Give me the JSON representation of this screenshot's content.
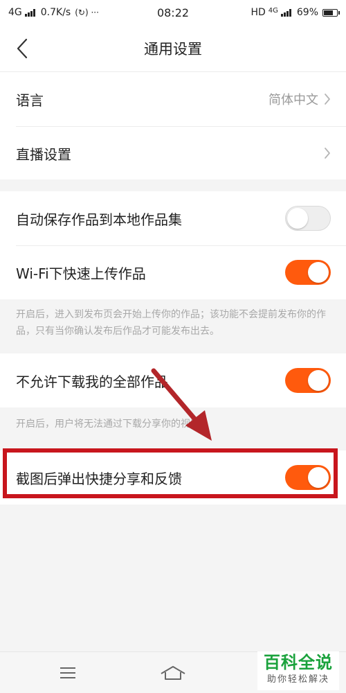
{
  "status_bar": {
    "network": "4G",
    "speed": "0.7K/s",
    "extra": "(↻) ···",
    "time": "08:22",
    "hd": "HD",
    "network_right": "4G",
    "battery": "69%"
  },
  "header": {
    "title": "通用设置",
    "back_icon": "chevron-left-icon"
  },
  "settings": {
    "language": {
      "label": "语言",
      "value": "简体中文"
    },
    "live": {
      "label": "直播设置"
    },
    "auto_save": {
      "label": "自动保存作品到本地作品集",
      "enabled": false
    },
    "wifi_upload": {
      "label": "Wi-Fi下快速上传作品",
      "enabled": true,
      "hint": "开启后，进入到发布页会开始上传你的作品；该功能不会提前发布你的作品，只有当你确认发布后作品才可能发布出去。"
    },
    "no_download": {
      "label": "不允许下载我的全部作品",
      "enabled": true,
      "hint": "开启后，用户将无法通过下载分享你的视频。"
    },
    "screenshot_share": {
      "label": "截图后弹出快捷分享和反馈",
      "enabled": true
    }
  },
  "bottom_nav": {
    "menu_icon": "menu-icon",
    "home_icon": "home-icon"
  },
  "watermark": {
    "title": "百科全说",
    "subtitle": "助你轻松解决"
  },
  "colors": {
    "accent": "#ff5a0d",
    "highlight": "#c8161d",
    "arrow": "#b3262a",
    "watermark": "#1aa23c"
  }
}
